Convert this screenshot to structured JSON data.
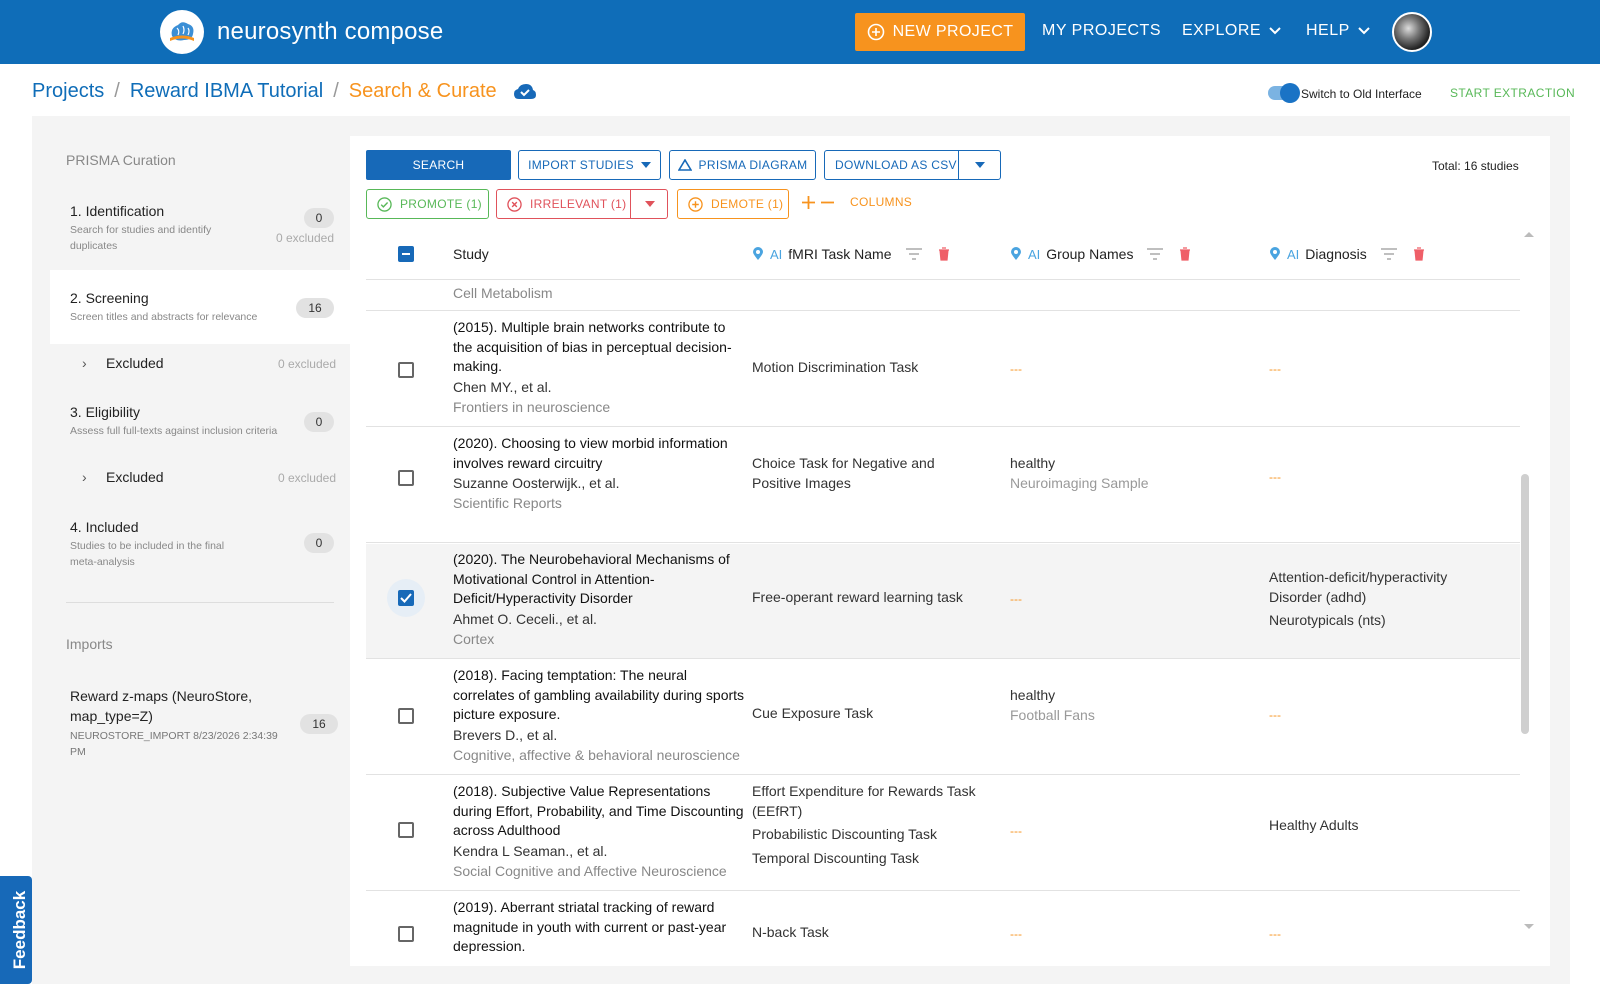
{
  "nav": {
    "brand": "neurosynth compose",
    "new_project": "NEW PROJECT",
    "my_projects": "MY PROJECTS",
    "explore": "EXPLORE",
    "help": "HELP"
  },
  "breadcrumb": {
    "projects": "Projects",
    "project": "Reward IBMA Tutorial",
    "current": "Search & Curate",
    "sep": "/"
  },
  "switch_label": "Switch to Old Interface",
  "start_extraction": "START EXTRACTION",
  "sidebar": {
    "title": "PRISMA Curation",
    "phases": [
      {
        "name": "1. Identification",
        "desc": "Search for studies and identify duplicates",
        "count": "0",
        "excluded": "0 excluded"
      },
      {
        "name": "2. Screening",
        "desc": "Screen titles and abstracts for relevance",
        "count": "16"
      },
      {
        "name": "3. Eligibility",
        "desc": "Assess full full-texts against inclusion criteria",
        "count": "0"
      },
      {
        "name": "4. Included",
        "desc": "Studies to be included in the final meta-analysis",
        "count": "0"
      }
    ],
    "screening_excluded": {
      "label": "Excluded",
      "count": "0 excluded"
    },
    "eligibility_excluded": {
      "label": "Excluded",
      "count": "0 excluded"
    },
    "imports_title": "Imports",
    "import": {
      "name": "Reward z-maps (NeuroStore, map_type=Z)",
      "meta": "NEUROSTORE_IMPORT 8/23/2026 2:34:39 PM",
      "count": "16"
    }
  },
  "toolbar": {
    "search": "SEARCH",
    "import_studies": "IMPORT STUDIES",
    "prisma_diagram": "PRISMA DIAGRAM",
    "download_csv": "DOWNLOAD AS CSV",
    "total": "Total: 16 studies",
    "promote": "PROMOTE (1)",
    "irrelevant": "IRRELEVANT (1)",
    "demote": "DEMOTE (1)",
    "columns": "COLUMNS"
  },
  "table": {
    "headers": {
      "study": "Study",
      "ai": "AI",
      "fmri": "fMRI Task Name",
      "groups": "Group Names",
      "diagnosis": "Diagnosis"
    },
    "partial_row": "Cell Metabolism",
    "rows": [
      {
        "title": "(2015). Multiple brain networks contribute to the acquisition of bias in perceptual decision-making.",
        "authors": "Chen MY., et al.",
        "journal": "Frontiers in neuroscience",
        "fmri": [
          "Motion Discrimination Task"
        ],
        "group": "---",
        "group_sub": "",
        "diagnosis": [
          "---"
        ],
        "checked": false
      },
      {
        "title": "(2020). Choosing to view morbid information involves reward circuitry",
        "authors": "Suzanne Oosterwijk., et al.",
        "journal": "Scientific Reports",
        "fmri": [
          "Choice Task for Negative and Positive Images"
        ],
        "group": "healthy",
        "group_sub": "Neuroimaging Sample",
        "diagnosis": [
          "---"
        ],
        "checked": false
      },
      {
        "title": "(2020). The Neurobehavioral Mechanisms of Motivational Control in Attention-Deficit/Hyperactivity Disorder",
        "authors": "Ahmet O. Ceceli., et al.",
        "journal": "Cortex",
        "fmri": [
          "Free-operant reward learning task"
        ],
        "group": "---",
        "group_sub": "",
        "diagnosis": [
          "Attention-deficit/hyperactivity Disorder (adhd)",
          "Neurotypicals (nts)"
        ],
        "checked": true
      },
      {
        "title": "(2018). Facing temptation: The neural correlates of gambling availability during sports picture exposure.",
        "authors": "Brevers D., et al.",
        "journal": "Cognitive, affective & behavioral neuroscience",
        "fmri": [
          "Cue Exposure Task"
        ],
        "group": "healthy",
        "group_sub": "Football Fans",
        "diagnosis": [
          "---"
        ],
        "checked": false
      },
      {
        "title": "(2018). Subjective Value Representations during Effort, Probability, and Time Discounting across Adulthood",
        "authors": "Kendra L Seaman., et al.",
        "journal": "Social Cognitive and Affective Neuroscience",
        "fmri": [
          "Effort Expenditure for Rewards Task (EEfRT)",
          "Probabilistic Discounting Task",
          "Temporal Discounting Task"
        ],
        "group": "---",
        "group_sub": "",
        "diagnosis": [
          "Healthy Adults"
        ],
        "checked": false
      },
      {
        "title": "(2019). Aberrant striatal tracking of reward magnitude in youth with current or past-year depression.",
        "authors": "",
        "journal": "",
        "fmri": [
          "N-back Task"
        ],
        "group": "---",
        "group_sub": "",
        "diagnosis": [
          "---"
        ],
        "checked": false
      }
    ]
  },
  "feedback": "Feedback",
  "colors": {
    "primary": "#1769b8",
    "accent": "#f7931e",
    "success": "#58b858",
    "danger": "#e0525b"
  }
}
